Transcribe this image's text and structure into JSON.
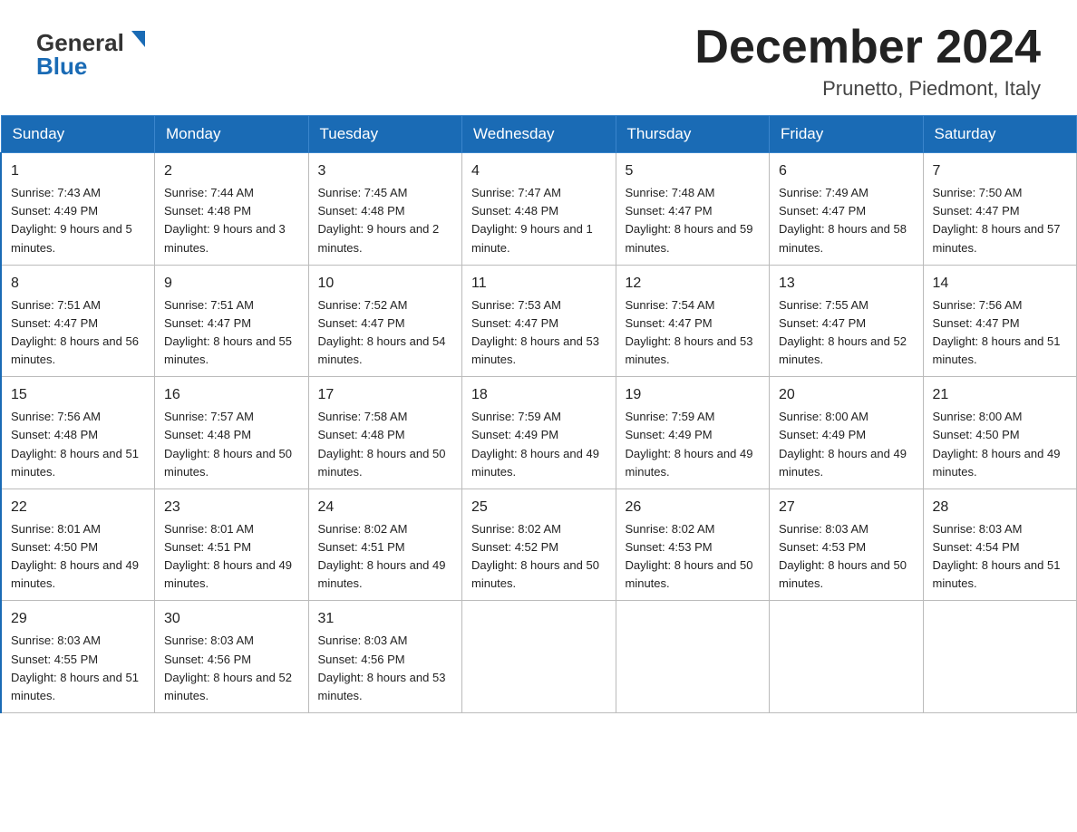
{
  "header": {
    "main_title": "December 2024",
    "subtitle": "Prunetto, Piedmont, Italy"
  },
  "logo": {
    "line1": "General",
    "line2": "Blue"
  },
  "days_of_week": [
    "Sunday",
    "Monday",
    "Tuesday",
    "Wednesday",
    "Thursday",
    "Friday",
    "Saturday"
  ],
  "weeks": [
    [
      {
        "day": "1",
        "sunrise": "7:43 AM",
        "sunset": "4:49 PM",
        "daylight": "9 hours and 5 minutes."
      },
      {
        "day": "2",
        "sunrise": "7:44 AM",
        "sunset": "4:48 PM",
        "daylight": "9 hours and 3 minutes."
      },
      {
        "day": "3",
        "sunrise": "7:45 AM",
        "sunset": "4:48 PM",
        "daylight": "9 hours and 2 minutes."
      },
      {
        "day": "4",
        "sunrise": "7:47 AM",
        "sunset": "4:48 PM",
        "daylight": "9 hours and 1 minute."
      },
      {
        "day": "5",
        "sunrise": "7:48 AM",
        "sunset": "4:47 PM",
        "daylight": "8 hours and 59 minutes."
      },
      {
        "day": "6",
        "sunrise": "7:49 AM",
        "sunset": "4:47 PM",
        "daylight": "8 hours and 58 minutes."
      },
      {
        "day": "7",
        "sunrise": "7:50 AM",
        "sunset": "4:47 PM",
        "daylight": "8 hours and 57 minutes."
      }
    ],
    [
      {
        "day": "8",
        "sunrise": "7:51 AM",
        "sunset": "4:47 PM",
        "daylight": "8 hours and 56 minutes."
      },
      {
        "day": "9",
        "sunrise": "7:51 AM",
        "sunset": "4:47 PM",
        "daylight": "8 hours and 55 minutes."
      },
      {
        "day": "10",
        "sunrise": "7:52 AM",
        "sunset": "4:47 PM",
        "daylight": "8 hours and 54 minutes."
      },
      {
        "day": "11",
        "sunrise": "7:53 AM",
        "sunset": "4:47 PM",
        "daylight": "8 hours and 53 minutes."
      },
      {
        "day": "12",
        "sunrise": "7:54 AM",
        "sunset": "4:47 PM",
        "daylight": "8 hours and 53 minutes."
      },
      {
        "day": "13",
        "sunrise": "7:55 AM",
        "sunset": "4:47 PM",
        "daylight": "8 hours and 52 minutes."
      },
      {
        "day": "14",
        "sunrise": "7:56 AM",
        "sunset": "4:47 PM",
        "daylight": "8 hours and 51 minutes."
      }
    ],
    [
      {
        "day": "15",
        "sunrise": "7:56 AM",
        "sunset": "4:48 PM",
        "daylight": "8 hours and 51 minutes."
      },
      {
        "day": "16",
        "sunrise": "7:57 AM",
        "sunset": "4:48 PM",
        "daylight": "8 hours and 50 minutes."
      },
      {
        "day": "17",
        "sunrise": "7:58 AM",
        "sunset": "4:48 PM",
        "daylight": "8 hours and 50 minutes."
      },
      {
        "day": "18",
        "sunrise": "7:59 AM",
        "sunset": "4:49 PM",
        "daylight": "8 hours and 49 minutes."
      },
      {
        "day": "19",
        "sunrise": "7:59 AM",
        "sunset": "4:49 PM",
        "daylight": "8 hours and 49 minutes."
      },
      {
        "day": "20",
        "sunrise": "8:00 AM",
        "sunset": "4:49 PM",
        "daylight": "8 hours and 49 minutes."
      },
      {
        "day": "21",
        "sunrise": "8:00 AM",
        "sunset": "4:50 PM",
        "daylight": "8 hours and 49 minutes."
      }
    ],
    [
      {
        "day": "22",
        "sunrise": "8:01 AM",
        "sunset": "4:50 PM",
        "daylight": "8 hours and 49 minutes."
      },
      {
        "day": "23",
        "sunrise": "8:01 AM",
        "sunset": "4:51 PM",
        "daylight": "8 hours and 49 minutes."
      },
      {
        "day": "24",
        "sunrise": "8:02 AM",
        "sunset": "4:51 PM",
        "daylight": "8 hours and 49 minutes."
      },
      {
        "day": "25",
        "sunrise": "8:02 AM",
        "sunset": "4:52 PM",
        "daylight": "8 hours and 50 minutes."
      },
      {
        "day": "26",
        "sunrise": "8:02 AM",
        "sunset": "4:53 PM",
        "daylight": "8 hours and 50 minutes."
      },
      {
        "day": "27",
        "sunrise": "8:03 AM",
        "sunset": "4:53 PM",
        "daylight": "8 hours and 50 minutes."
      },
      {
        "day": "28",
        "sunrise": "8:03 AM",
        "sunset": "4:54 PM",
        "daylight": "8 hours and 51 minutes."
      }
    ],
    [
      {
        "day": "29",
        "sunrise": "8:03 AM",
        "sunset": "4:55 PM",
        "daylight": "8 hours and 51 minutes."
      },
      {
        "day": "30",
        "sunrise": "8:03 AM",
        "sunset": "4:56 PM",
        "daylight": "8 hours and 52 minutes."
      },
      {
        "day": "31",
        "sunrise": "8:03 AM",
        "sunset": "4:56 PM",
        "daylight": "8 hours and 53 minutes."
      },
      null,
      null,
      null,
      null
    ]
  ],
  "labels": {
    "sunrise": "Sunrise:",
    "sunset": "Sunset:",
    "daylight": "Daylight:"
  }
}
